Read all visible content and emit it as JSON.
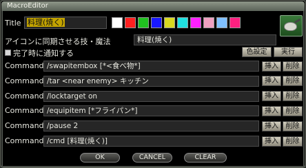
{
  "window": {
    "title": "MacroEditor"
  },
  "title_field": {
    "label": "Title",
    "value": "料理(焼く)"
  },
  "swatches": [
    "#ffffff",
    "#ff2020",
    "#20c020",
    "#1818ff",
    "#d8d820",
    "#20e0e0",
    "#ff20ff",
    "#f0a0c0",
    "#80c0ff",
    "#ff2080"
  ],
  "icon": {
    "name": "frying-pan-icon"
  },
  "sync": {
    "label": "アイコンに同期させる技・魔法",
    "value": "料理(焼く)"
  },
  "notify": {
    "label": "完了時に通知する",
    "checked": false
  },
  "buttons": {
    "color_settings": "色設定",
    "execute": "実行",
    "insert": "挿入",
    "delete": "削除",
    "ok": "OK",
    "cancel": "CANCEL",
    "clear": "CLEAR"
  },
  "commands": [
    {
      "label": "Command1",
      "value": "/swapitembox [*<食べ物*]"
    },
    {
      "label": "Command2",
      "value": "/tar <near enemy> キッチン"
    },
    {
      "label": "Command3",
      "value": "/locktarget on"
    },
    {
      "label": "Command4",
      "value": "/equipitem [*フライパン*]"
    },
    {
      "label": "Command5",
      "value": "/pause 2"
    },
    {
      "label": "Command6",
      "value": "/cmd [料理(焼く)]"
    }
  ]
}
